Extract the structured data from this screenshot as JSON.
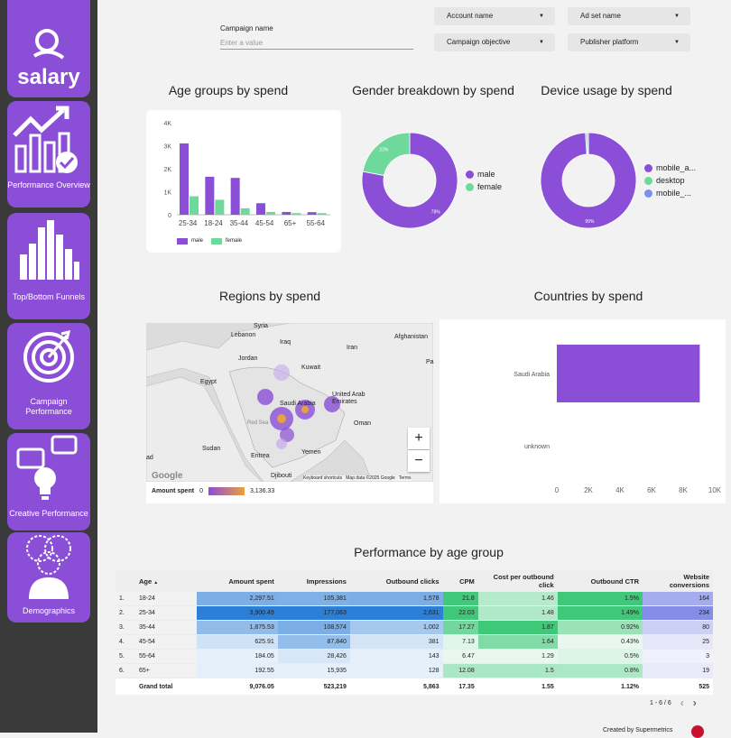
{
  "sidebar": {
    "brand": "salary",
    "items": [
      {
        "label": "Performance Overview"
      },
      {
        "label": "Top/Bottom Funnels"
      },
      {
        "label": "Campaign Performance"
      },
      {
        "label": "Creative Performance"
      },
      {
        "label": "Demographics"
      }
    ]
  },
  "filters": {
    "campaign_name_label": "Campaign name",
    "campaign_name_placeholder": "Enter a value",
    "account_name": "Account name",
    "adset_name": "Ad set name",
    "campaign_objective": "Campaign objective",
    "publisher_platform": "Publisher platform"
  },
  "titles": {
    "age_groups": "Age groups by spend",
    "gender": "Gender breakdown by spend",
    "device": "Device usage by spend",
    "regions": "Regions by spend",
    "countries": "Countries by spend",
    "perf_age": "Performance by age group"
  },
  "chart_data": [
    {
      "type": "bar",
      "title": "Age groups by spend",
      "categories": [
        "25-34",
        "18-24",
        "35-44",
        "45-54",
        "65+",
        "55-64"
      ],
      "series": [
        {
          "name": "male",
          "values": [
            3100,
            1650,
            1600,
            500,
            120,
            110
          ],
          "color": "#8a4fd6"
        },
        {
          "name": "female",
          "values": [
            800,
            650,
            280,
            120,
            70,
            70
          ],
          "color": "#6fd89b"
        }
      ],
      "yticks": [
        "0",
        "1K",
        "2K",
        "3K",
        "4K"
      ],
      "ylim": [
        0,
        4000
      ]
    },
    {
      "type": "pie",
      "title": "Gender breakdown by spend",
      "slices": [
        {
          "name": "male",
          "value": 78,
          "label": "78%",
          "color": "#8a4fd6"
        },
        {
          "name": "female",
          "value": 22,
          "label": "22%",
          "color": "#6fd89b"
        }
      ]
    },
    {
      "type": "pie",
      "title": "Device usage by spend",
      "slices": [
        {
          "name": "mobile_a...",
          "value": 99,
          "label": "99%",
          "color": "#8a4fd6"
        },
        {
          "name": "desktop",
          "value": 0.6,
          "label": "",
          "color": "#6fd89b"
        },
        {
          "name": "mobile_...",
          "value": 0.4,
          "label": "",
          "color": "#7f8fe6"
        }
      ]
    },
    {
      "type": "bar",
      "title": "Countries by spend",
      "categories": [
        "Saudi Arabia",
        "unknown"
      ],
      "values": [
        9050,
        0
      ],
      "xticks": [
        "0",
        "2K",
        "4K",
        "6K",
        "8K",
        "10K"
      ],
      "xlim": [
        0,
        10000
      ]
    }
  ],
  "map": {
    "labels": [
      "Syria",
      "Lebanon",
      "Iraq",
      "Iran",
      "Afghanistan",
      "Jordan",
      "Kuwait",
      "Egypt",
      "Saudi Arabia",
      "United Arab Emirates",
      "Oman",
      "Sudan",
      "Eritrea",
      "Yemen",
      "Djibouti",
      "Pa",
      "Red Sea",
      "ad"
    ],
    "legend_title": "Amount spent",
    "legend_min": "0",
    "legend_max": "3,136.33",
    "attribution": "Keyboard shortcuts",
    "mapdata": "Map data ©2025 Google",
    "terms": "Terms",
    "google": "Google",
    "zoom_in": "+",
    "zoom_out": "−"
  },
  "table": {
    "headers": [
      "Age",
      "Amount spent",
      "Impressions",
      "Outbound clicks",
      "CPM",
      "Cost per outbound click",
      "Outbound CTR",
      "Website conversions"
    ],
    "sort_icon": "▲",
    "rows": [
      {
        "idx": "1.",
        "age": "18-24",
        "spend": "2,297.51",
        "impr": "105,381",
        "clicks": "1,578",
        "cpm": "21.8",
        "cpc": "1.46",
        "ctr": "1.5%",
        "conv": "164"
      },
      {
        "idx": "2.",
        "age": "25-34",
        "spend": "3,900.49",
        "impr": "177,063",
        "clicks": "2,631",
        "cpm": "22.03",
        "cpc": "1.48",
        "ctr": "1.49%",
        "conv": "234"
      },
      {
        "idx": "3.",
        "age": "35-44",
        "spend": "1,875.53",
        "impr": "108,574",
        "clicks": "1,002",
        "cpm": "17.27",
        "cpc": "1.87",
        "ctr": "0.92%",
        "conv": "80"
      },
      {
        "idx": "4.",
        "age": "45-54",
        "spend": "625.91",
        "impr": "87,840",
        "clicks": "381",
        "cpm": "7.13",
        "cpc": "1.64",
        "ctr": "0.43%",
        "conv": "25"
      },
      {
        "idx": "5.",
        "age": "55-64",
        "spend": "184.05",
        "impr": "28,426",
        "clicks": "143",
        "cpm": "6.47",
        "cpc": "1.29",
        "ctr": "0.5%",
        "conv": "3"
      },
      {
        "idx": "6.",
        "age": "65+",
        "spend": "192.55",
        "impr": "15,935",
        "clicks": "128",
        "cpm": "12.08",
        "cpc": "1.5",
        "ctr": "0.8%",
        "conv": "19"
      }
    ],
    "total": {
      "label": "Grand total",
      "spend": "9,076.05",
      "impr": "523,219",
      "clicks": "5,863",
      "cpm": "17.35",
      "cpc": "1.55",
      "ctr": "1.12%",
      "conv": "525"
    },
    "pagination": "1 - 6 / 6",
    "prev": "‹",
    "next": "›"
  },
  "footer": {
    "text": "Created by Supermetrics"
  }
}
